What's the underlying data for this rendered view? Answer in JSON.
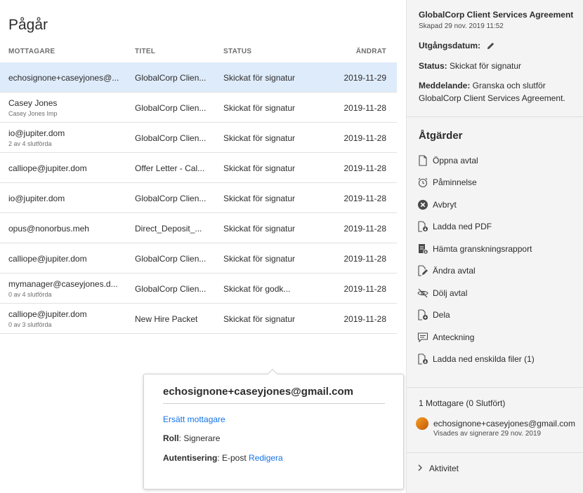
{
  "list": {
    "title": "Pågår",
    "headers": {
      "recipient": "MOTTAGARE",
      "title": "TITEL",
      "status": "STATUS",
      "changed": "ÄNDRAT"
    },
    "rows": [
      {
        "recipient": "echosignone+caseyjones@...",
        "sub": "",
        "title": "GlobalCorp Clien...",
        "status": "Skickat för signatur",
        "date": "2019-11-29",
        "selected": true
      },
      {
        "recipient": "Casey Jones",
        "sub": "Casey Jones Imp",
        "title": "GlobalCorp Clien...",
        "status": "Skickat för signatur",
        "date": "2019-11-28"
      },
      {
        "recipient": "io@jupiter.dom",
        "sub": "2 av 4 slutförda",
        "title": "GlobalCorp Clien...",
        "status": "Skickat för signatur",
        "date": "2019-11-28"
      },
      {
        "recipient": "calliope@jupiter.dom",
        "sub": "",
        "title": "Offer Letter - Cal...",
        "status": "Skickat för signatur",
        "date": "2019-11-28"
      },
      {
        "recipient": "io@jupiter.dom",
        "sub": "",
        "title": "GlobalCorp Clien...",
        "status": "Skickat för signatur",
        "date": "2019-11-28"
      },
      {
        "recipient": "opus@nonorbus.meh",
        "sub": "",
        "title": "Direct_Deposit_...",
        "status": "Skickat för signatur",
        "date": "2019-11-28"
      },
      {
        "recipient": "calliope@jupiter.dom",
        "sub": "",
        "title": "GlobalCorp Clien...",
        "status": "Skickat för signatur",
        "date": "2019-11-28"
      },
      {
        "recipient": "mymanager@caseyjones.d...",
        "sub": "0 av 4 slutförda",
        "title": "GlobalCorp Clien...",
        "status": "Skickat för godk...",
        "date": "2019-11-28"
      },
      {
        "recipient": "calliope@jupiter.dom",
        "sub": "0 av 3 slutförda",
        "title": "New Hire Packet",
        "status": "Skickat för signatur",
        "date": "2019-11-28"
      }
    ]
  },
  "popover": {
    "email": "echosignone+caseyjones@gmail.com",
    "replace_link": "Ersätt mottagare",
    "role_label": "Roll",
    "role_value": ": Signerare",
    "auth_label": "Autentisering",
    "auth_value": ": E-post ",
    "auth_edit": "Redigera"
  },
  "panel": {
    "title": "GlobalCorp Client Services Agreement",
    "created": "Skapad 29 nov. 2019 11:52",
    "expiry_label": "Utgångsdatum:",
    "status_label": "Status:",
    "status_value": " Skickat för signatur",
    "message_label": "Meddelande:",
    "message_value": " Granska och slutför GlobalCorp Client Services Agreement.",
    "actions_title": "Åtgärder",
    "actions": [
      {
        "label": "Öppna avtal",
        "icon": "document-icon"
      },
      {
        "label": "Påminnelse",
        "icon": "alarm-clock-icon"
      },
      {
        "label": "Avbryt",
        "icon": "cancel-circle-icon"
      },
      {
        "label": "Ladda ned PDF",
        "icon": "pdf-download-icon"
      },
      {
        "label": "Hämta granskningsrapport",
        "icon": "audit-report-icon"
      },
      {
        "label": "Ändra avtal",
        "icon": "edit-document-icon"
      },
      {
        "label": "Dölj avtal",
        "icon": "eye-off-icon"
      },
      {
        "label": "Dela",
        "icon": "share-document-icon"
      },
      {
        "label": "Anteckning",
        "icon": "note-icon"
      },
      {
        "label": "Ladda ned enskilda filer (1)",
        "icon": "files-download-icon"
      }
    ],
    "recipients_count": "1 Mottagare (0 Slutfört)",
    "recipient_email": "echosignone+caseyjones@gmail.com",
    "recipient_note": "Visades av signerare 29 nov. 2019",
    "activity": "Aktivitet"
  }
}
